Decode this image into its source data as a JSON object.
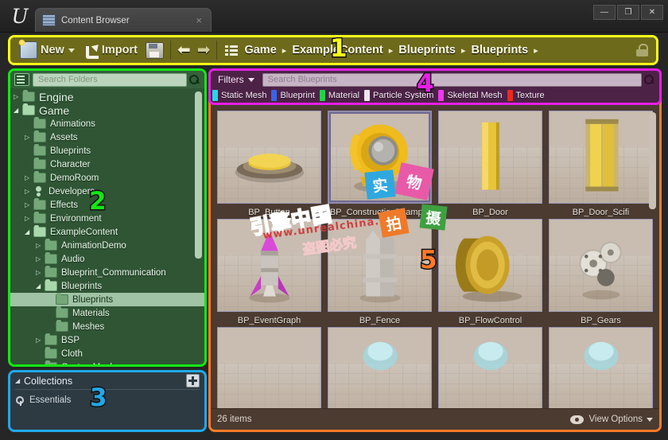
{
  "window": {
    "tab_title": "Content Browser",
    "tab_close": "×",
    "minimize": "—",
    "maximize": "❐",
    "close": "✕",
    "logo": "U"
  },
  "toolbar": {
    "new_label": "New",
    "import_label": "Import",
    "save_name": "save-all-button",
    "back_name": "back-button",
    "forward_name": "forward-button",
    "lock_name": "lock-icon"
  },
  "breadcrumb": {
    "items": [
      "Game",
      "ExampleContent",
      "Blueprints",
      "Blueprints"
    ],
    "separator": "▸"
  },
  "folder_search": {
    "placeholder": "Search Folders"
  },
  "tree": {
    "items": [
      {
        "label": "Engine",
        "indent": 0,
        "arrow": "▷",
        "big": true,
        "selected": false,
        "icon": "folder"
      },
      {
        "label": "Game",
        "indent": 0,
        "arrow": "◢",
        "big": true,
        "selected": false,
        "icon": "folder-open"
      },
      {
        "label": "Animations",
        "indent": 1,
        "arrow": "",
        "big": false,
        "selected": false,
        "icon": "folder"
      },
      {
        "label": "Assets",
        "indent": 1,
        "arrow": "▷",
        "big": false,
        "selected": false,
        "icon": "folder"
      },
      {
        "label": "Blueprints",
        "indent": 1,
        "arrow": "",
        "big": false,
        "selected": false,
        "icon": "folder"
      },
      {
        "label": "Character",
        "indent": 1,
        "arrow": "",
        "big": false,
        "selected": false,
        "icon": "folder"
      },
      {
        "label": "DemoRoom",
        "indent": 1,
        "arrow": "▷",
        "big": false,
        "selected": false,
        "icon": "folder"
      },
      {
        "label": "Developers",
        "indent": 1,
        "arrow": "▷",
        "big": false,
        "selected": false,
        "icon": "developer"
      },
      {
        "label": "Effects",
        "indent": 1,
        "arrow": "▷",
        "big": false,
        "selected": false,
        "icon": "folder"
      },
      {
        "label": "Environment",
        "indent": 1,
        "arrow": "▷",
        "big": false,
        "selected": false,
        "icon": "folder"
      },
      {
        "label": "ExampleContent",
        "indent": 1,
        "arrow": "◢",
        "big": false,
        "selected": false,
        "icon": "folder-open"
      },
      {
        "label": "AnimationDemo",
        "indent": 2,
        "arrow": "▷",
        "big": false,
        "selected": false,
        "icon": "folder"
      },
      {
        "label": "Audio",
        "indent": 2,
        "arrow": "▷",
        "big": false,
        "selected": false,
        "icon": "folder"
      },
      {
        "label": "Blueprint_Communication",
        "indent": 2,
        "arrow": "▷",
        "big": false,
        "selected": false,
        "icon": "folder"
      },
      {
        "label": "Blueprints",
        "indent": 2,
        "arrow": "◢",
        "big": false,
        "selected": false,
        "icon": "folder-open"
      },
      {
        "label": "Blueprints",
        "indent": 3,
        "arrow": "",
        "big": false,
        "selected": true,
        "icon": "folder"
      },
      {
        "label": "Materials",
        "indent": 3,
        "arrow": "",
        "big": false,
        "selected": false,
        "icon": "folder"
      },
      {
        "label": "Meshes",
        "indent": 3,
        "arrow": "",
        "big": false,
        "selected": false,
        "icon": "folder"
      },
      {
        "label": "BSP",
        "indent": 2,
        "arrow": "▷",
        "big": false,
        "selected": false,
        "icon": "folder"
      },
      {
        "label": "Cloth",
        "indent": 2,
        "arrow": "",
        "big": false,
        "selected": false,
        "icon": "folder"
      },
      {
        "label": "CustomMesh",
        "indent": 2,
        "arrow": "▷",
        "big": false,
        "selected": false,
        "icon": "folder"
      }
    ]
  },
  "collections": {
    "title": "Collections",
    "arrow": "◢",
    "items": [
      {
        "label": "Essentials"
      }
    ]
  },
  "filters": {
    "button_label": "Filters",
    "search_placeholder": "Search Blueprints",
    "chips": [
      {
        "label": "Static Mesh",
        "color": "#23d9e8"
      },
      {
        "label": "Blueprint",
        "color": "#3a63e8"
      },
      {
        "label": "Material",
        "color": "#23d24a"
      },
      {
        "label": "Particle System",
        "color": "#f0e6f0"
      },
      {
        "label": "Skeletal Mesh",
        "color": "#ec3aec"
      },
      {
        "label": "Texture",
        "color": "#e82a20"
      }
    ]
  },
  "assets": {
    "rows": [
      [
        {
          "name": "BP_Button",
          "selected": false,
          "shape": "button-pad"
        },
        {
          "name": "BP_ConstructionExample",
          "selected": true,
          "shape": "yellow-robot"
        },
        {
          "name": "BP_Door",
          "selected": false,
          "shape": "door"
        },
        {
          "name": "BP_Door_Scifi",
          "selected": false,
          "shape": "door-scifi"
        }
      ],
      [
        {
          "name": "BP_EventGraph",
          "selected": false,
          "shape": "rocket"
        },
        {
          "name": "BP_Fence",
          "selected": false,
          "shape": "fence"
        },
        {
          "name": "BP_FlowControl",
          "selected": false,
          "shape": "gold-coin"
        },
        {
          "name": "BP_Gears",
          "selected": false,
          "shape": "gears"
        }
      ],
      [
        {
          "name": "",
          "selected": false,
          "shape": "partial-empty"
        },
        {
          "name": "",
          "selected": false,
          "shape": "partial-glass"
        },
        {
          "name": "",
          "selected": false,
          "shape": "partial-glass"
        },
        {
          "name": "",
          "selected": false,
          "shape": "partial-glass"
        }
      ]
    ]
  },
  "status": {
    "item_count": "26 items",
    "view_options": "View Options"
  },
  "badges": [
    {
      "number": "1",
      "color": "#ffff18",
      "target": "breadcrumb-toolbar"
    },
    {
      "number": "2",
      "color": "#12e712",
      "target": "folder-tree"
    },
    {
      "number": "3",
      "color": "#21a8e8",
      "target": "collections-panel"
    },
    {
      "number": "4",
      "color": "#e81ee8",
      "target": "filter-bar"
    },
    {
      "number": "5",
      "color": "#ff7a28",
      "target": "asset-grid"
    }
  ],
  "watermarks": {
    "main": "引擎中国",
    "sub": "www.unrealchina.com",
    "warn": "盗图必究",
    "squares": [
      "实",
      "物",
      "拍",
      "摄"
    ]
  }
}
